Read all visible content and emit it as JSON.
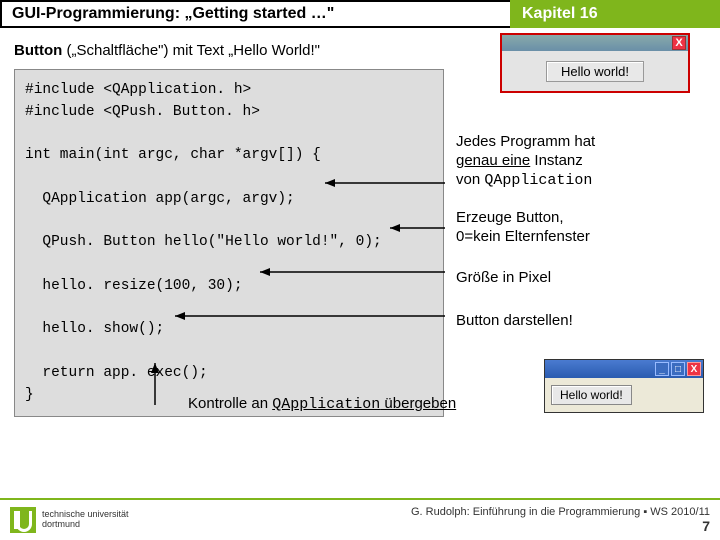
{
  "header": {
    "left": "GUI-Programmierung: „Getting started …\"",
    "right": "Kapitel 16"
  },
  "subtitle_bold": "Button",
  "subtitle_rest": " („Schaltfläche\") mit Text „Hello World!\"",
  "code": "#include <QApplication. h>\n#include <QPush. Button. h>\n\nint main(int argc, char *argv[]) {\n\n  QApplication app(argc, argv);\n\n  QPush. Button hello(\"Hello world!\", 0);\n\n  hello. resize(100, 30);\n\n  hello. show();\n\n  return app. exec();\n}",
  "win": {
    "close": "X",
    "btn": "Hello world!"
  },
  "notes": {
    "n1a": "Jedes Programm hat",
    "n1b_u": "genau eine",
    "n1b_r": " Instanz",
    "n1c": "von ",
    "n1d_mono": "QApplication",
    "n2a": "Erzeuge Button,",
    "n2b": "0=kein Elternfenster",
    "n3": "Größe in Pixel",
    "n4": "Button darstellen!"
  },
  "tiny": {
    "btn": "Hello world!",
    "min": "_",
    "max": "□",
    "close": "X"
  },
  "bottom_a": "Kontrolle an ",
  "bottom_mono": "QApplication",
  "bottom_b": " übergeben",
  "footer": {
    "uni1": "technische universität",
    "uni2": "dortmund",
    "credit": "G. Rudolph: Einführung in die Programmierung ▪ WS 2010/11",
    "page": "7"
  }
}
